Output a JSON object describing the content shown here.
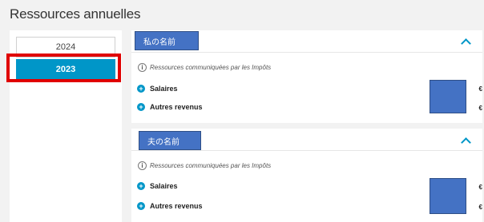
{
  "page": {
    "title": "Ressources annuelles"
  },
  "years": {
    "items": [
      {
        "label": "2024",
        "selected": false
      },
      {
        "label": "2023",
        "selected": true
      }
    ]
  },
  "colors": {
    "accent": "#0096c8",
    "highlight": "#e00000",
    "redaction": "#4472c4"
  },
  "cards": [
    {
      "name_label": "私の名前",
      "info_text": "Ressources communiquées par les Impôts",
      "rows": [
        {
          "label": "Salaires",
          "currency": "€"
        },
        {
          "label": "Autres revenus",
          "currency": "€"
        }
      ]
    },
    {
      "name_label": "夫の名前",
      "info_text": "Ressources communiquées par les Impôts",
      "rows": [
        {
          "label": "Salaires",
          "currency": "€"
        },
        {
          "label": "Autres revenus",
          "currency": "€"
        }
      ]
    }
  ]
}
